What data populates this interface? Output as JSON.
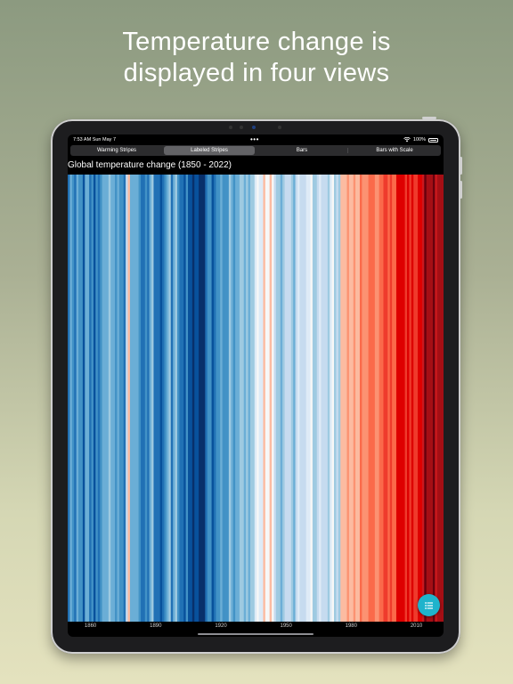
{
  "headline": {
    "line1": "Temperature change is",
    "line2": "displayed in four views"
  },
  "status_bar": {
    "time": "7:53 AM  Sun May 7",
    "battery": "100%"
  },
  "tabs": [
    {
      "label": "Warming Stripes",
      "selected": false
    },
    {
      "label": "Labeled Stripes",
      "selected": true
    },
    {
      "label": "Bars",
      "selected": false
    },
    {
      "label": "Bars with Scale",
      "selected": false
    }
  ],
  "colors": {
    "accent": "#1fb3cc",
    "cold": "#08306b",
    "warm": "#67000d",
    "neutral": "#ffffff"
  },
  "chart_data": {
    "type": "heatmap",
    "title": "Global temperature change (1850 - 2022)",
    "x_range": [
      1850,
      2022
    ],
    "x_ticks": [
      1860,
      1890,
      1920,
      1950,
      1980,
      2010
    ],
    "years": [
      1850,
      2022
    ],
    "anomalies": [
      -0.42,
      -0.25,
      -0.32,
      -0.44,
      -0.27,
      -0.33,
      -0.36,
      -0.51,
      -0.31,
      -0.31,
      -0.42,
      -0.39,
      -0.57,
      -0.33,
      -0.46,
      -0.33,
      -0.26,
      -0.31,
      -0.28,
      -0.19,
      -0.3,
      -0.3,
      -0.35,
      -0.27,
      -0.32,
      -0.38,
      -0.41,
      -0.05,
      0.06,
      -0.25,
      -0.3,
      -0.23,
      -0.28,
      -0.33,
      -0.41,
      -0.41,
      -0.37,
      -0.42,
      -0.3,
      -0.2,
      -0.45,
      -0.42,
      -0.47,
      -0.49,
      -0.44,
      -0.38,
      -0.25,
      -0.2,
      -0.4,
      -0.27,
      -0.21,
      -0.34,
      -0.42,
      -0.45,
      -0.54,
      -0.35,
      -0.5,
      -0.57,
      -0.61,
      -0.53,
      -0.56,
      -0.59,
      -0.58,
      -0.58,
      -0.48,
      -0.35,
      -0.34,
      -0.49,
      -0.44,
      -0.35,
      -0.33,
      -0.3,
      -0.33,
      -0.35,
      -0.35,
      -0.22,
      -0.31,
      -0.37,
      -0.28,
      -0.25,
      -0.22,
      -0.19,
      -0.28,
      -0.14,
      -0.26,
      -0.22,
      -0.16,
      -0.02,
      0.01,
      -0.03,
      -0.01,
      0.06,
      0.01,
      0.02,
      0.16,
      0.03,
      -0.1,
      -0.14,
      -0.15,
      -0.26,
      -0.16,
      -0.07,
      -0.11,
      -0.06,
      -0.22,
      -0.28,
      -0.08,
      -0.03,
      -0.11,
      -0.05,
      -0.06,
      -0.01,
      -0.04,
      0.04,
      -0.22,
      -0.14,
      -0.1,
      -0.02,
      -0.11,
      -0.06,
      -0.08,
      -0.17,
      -0.02,
      0.02,
      -0.17,
      -0.05,
      -0.14,
      0.14,
      0.09,
      0.06,
      0.22,
      0.12,
      0.1,
      0.19,
      0.09,
      0.16,
      0.33,
      0.25,
      0.28,
      0.2,
      0.3,
      0.37,
      0.4,
      0.24,
      0.27,
      0.32,
      0.39,
      0.5,
      0.44,
      0.41,
      0.52,
      0.4,
      0.39,
      0.57,
      0.54,
      0.58,
      0.55,
      0.52,
      0.58,
      0.47,
      0.61,
      0.47,
      0.51,
      0.55,
      0.63,
      0.76,
      0.91,
      0.82,
      0.78,
      0.85,
      0.96,
      0.72,
      0.87,
      0.89,
      0.85
    ]
  },
  "fab": {
    "icon": "list-icon"
  }
}
